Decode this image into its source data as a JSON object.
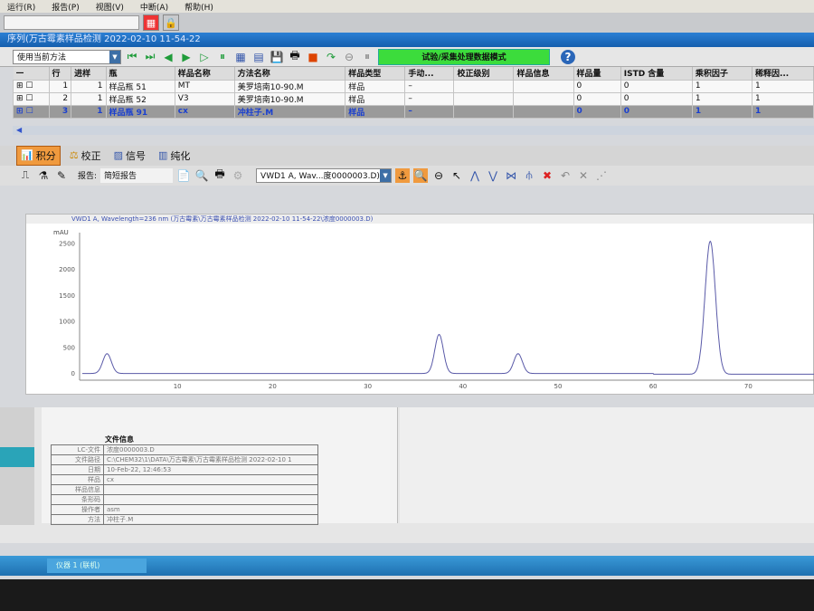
{
  "menu": [
    "运行(R)",
    "报告(P)",
    "视图(V)",
    "中断(A)",
    "帮助(H)"
  ],
  "window_title": "序列(万古霉素样品检测 2022-02-10 11-54-22",
  "method_select": "使用当前方法",
  "mode_label": "试验/采集处理数据模式",
  "help_icon": "?",
  "table": {
    "headers": [
      "—",
      "行",
      "进样",
      "瓶",
      "样品名称",
      "方法名称",
      "样品类型",
      "手动...",
      "校正级别",
      "样品信息",
      "样品量",
      "ISTD 含量",
      "乘积因子",
      "稀释因..."
    ],
    "rows": [
      {
        "row": "1",
        "inj": "1",
        "vial": "样品瓶 51",
        "name": "MT",
        "method": "美罗培南10-90.M",
        "type": "样品",
        "manual": "–",
        "amount": "0",
        "istd": "0",
        "mult": "1",
        "dil": "1"
      },
      {
        "row": "2",
        "inj": "1",
        "vial": "样品瓶 52",
        "name": "V3",
        "method": "美罗培南10-90.M",
        "type": "样品",
        "manual": "–",
        "amount": "0",
        "istd": "0",
        "mult": "1",
        "dil": "1"
      },
      {
        "row": "3",
        "inj": "1",
        "vial": "样品瓶 91",
        "name": "cx",
        "method": "冲柱子.M",
        "type": "样品",
        "manual": "–",
        "amount": "0",
        "istd": "0",
        "mult": "1",
        "dil": "1"
      }
    ]
  },
  "tabs": [
    "积分",
    "校正",
    "信号",
    "纯化"
  ],
  "report_label": "报告:",
  "report_value": "简短报告",
  "signal_select": "VWD1 A, Wav...度0000003.D)",
  "chart_data": {
    "type": "line",
    "title": "VWD1 A, Wavelength=236 nm (万古霉素\\万古霉素样品检测 2022-02-10 11-54-22\\浓度0000003.D)",
    "ylabel": "mAU",
    "xlabel": "",
    "xlim": [
      0,
      77
    ],
    "ylim": [
      -100,
      2700
    ],
    "xticks": [
      10,
      20,
      30,
      40,
      50,
      60,
      70
    ],
    "yticks": [
      0,
      500,
      1000,
      1500,
      2000,
      2500
    ],
    "peaks": [
      {
        "rt": 2.6,
        "height": 380
      },
      {
        "rt": 37.5,
        "height": 750
      },
      {
        "rt": 45.8,
        "height": 380
      },
      {
        "rt": 66.0,
        "height": 2560
      }
    ]
  },
  "file_info": {
    "title": "文件信息",
    "rows": [
      [
        "LC-文件",
        "浓度0000003.D"
      ],
      [
        "文件路径",
        "C:\\CHEM32\\1\\DATA\\万古霉素\\万古霉素样品检测 2022-02-10 1"
      ],
      [
        "日期",
        "10-Feb-22, 12:46:53"
      ],
      [
        "样品",
        "cx"
      ],
      [
        "样品信息",
        ""
      ],
      [
        "条形码",
        ""
      ],
      [
        "操作者",
        "asm"
      ],
      [
        "方法",
        "冲柱子.M"
      ]
    ]
  },
  "taskbar": "仪器 1 (联机)"
}
